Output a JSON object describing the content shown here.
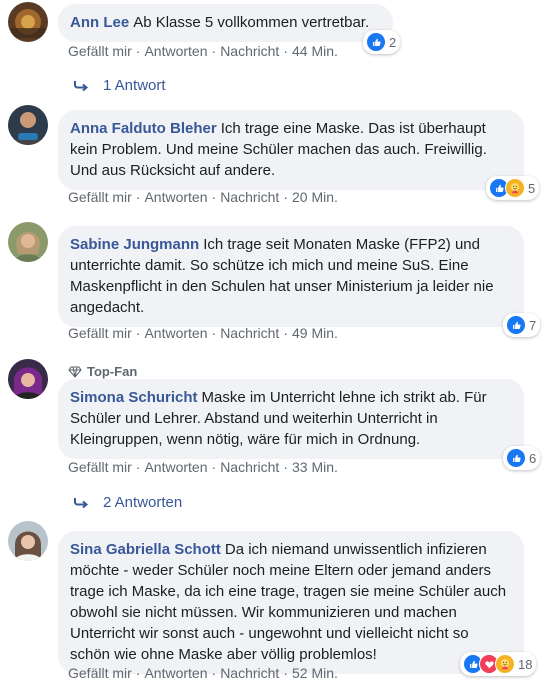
{
  "actions": {
    "like": "Gefällt mir",
    "reply": "Antworten",
    "message": "Nachricht",
    "separator": "·"
  },
  "comments": [
    {
      "author": "Ann Lee",
      "text": "Ab Klasse 5 vollkommen vertretbar.",
      "time": "44 Min.",
      "reactions": {
        "types": [
          "like"
        ],
        "count": "2"
      },
      "replies_label": "1 Antwort"
    },
    {
      "author": "Anna Falduto Bleher",
      "text": "Ich trage eine Maske. Das ist überhaupt kein Problem. Und meine Schüler machen das auch. Freiwillig. Und aus Rücksicht auf andere.",
      "time": "20 Min.",
      "reactions": {
        "types": [
          "like",
          "care"
        ],
        "count": "5"
      }
    },
    {
      "author": "Sabine Jungmann",
      "text": "Ich trage seit Monaten Maske (FFP2) und unterrichte damit. So schütze ich mich und meine SuS. Eine Maskenpflicht in den Schulen hat unser Ministerium ja leider nie angedacht.",
      "time": "49 Min.",
      "reactions": {
        "types": [
          "like"
        ],
        "count": "7"
      }
    },
    {
      "badge": "Top-Fan",
      "author": "Simona Schuricht",
      "text": "Maske im Unterricht lehne ich strikt ab. Für Schüler und Lehrer. Abstand und weiterhin Unterricht in Kleingruppen, wenn nötig, wäre für mich in Ordnung.",
      "time": "33 Min.",
      "reactions": {
        "types": [
          "like"
        ],
        "count": "6"
      },
      "replies_label": "2 Antworten"
    },
    {
      "author": "Sina Gabriella Schott",
      "text": "Da ich niemand unwissentlich infizieren möchte - weder Schüler noch meine Eltern oder jemand anders trage ich Maske, da ich eine trage, tragen sie meine Schüler auch obwohl sie nicht müssen. Wir kommunizieren und machen Unterricht wir sonst auch - ungewohnt und vielleicht nicht so schön wie ohne Maske aber völlig problemlos!",
      "time": "52 Min.",
      "reactions": {
        "types": [
          "like",
          "love",
          "care"
        ],
        "count": "18"
      }
    }
  ],
  "colors": {
    "bubble": "#f0f2f5",
    "author": "#385898",
    "meta": "#606770",
    "like": "#1877f2",
    "love": "#f33e58",
    "care": "#f7b125"
  },
  "icons": [
    "avatar",
    "like-icon",
    "love-icon",
    "care-icon",
    "reply-arrow-icon",
    "diamond-icon"
  ]
}
